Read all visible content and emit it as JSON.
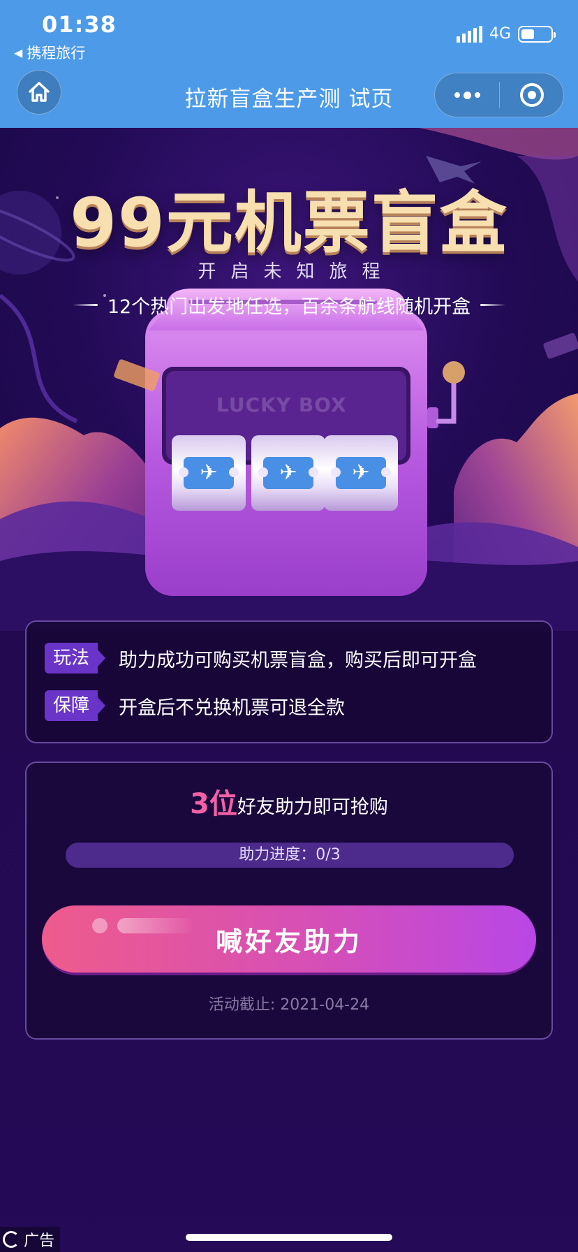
{
  "status_bar": {
    "time": "01:38",
    "back_app": "携程旅行",
    "network": "4G",
    "battery_level": 0.45
  },
  "header": {
    "title": "拉新盲盒生产测 试页",
    "home_icon": "home-icon",
    "more_icon": "more-dots-icon",
    "close_icon": "target-close-icon"
  },
  "banner": {
    "title": "99元机票盲盒",
    "tagline": "开启未知旅程",
    "subline": "12个热门出发地任选，百余条航线随机开盒",
    "machine_label": "LUCKY BOX",
    "reel_icons": [
      "plane-ticket-icon",
      "plane-ticket-icon",
      "plane-ticket-icon"
    ]
  },
  "info": {
    "rules": [
      {
        "tag": "玩法",
        "text": "助力成功可购买机票盲盒，购买后即可开盒"
      },
      {
        "tag": "保障",
        "text": "开盒后不兑换机票可退全款"
      }
    ]
  },
  "help": {
    "count": "3位",
    "title_rest": "好友助力即可抢购",
    "progress_text": "助力进度：0/3",
    "progress_value": 0,
    "progress_total": 3,
    "cta_label": "喊好友助力",
    "deadline": "活动截止: 2021-04-24"
  },
  "footer": {
    "ad_label": "广告"
  },
  "colors": {
    "header_bg": "#4c9ae8",
    "page_bg": "#1d0a45",
    "accent_pink": "#f261a6",
    "cta_start": "#ee5b8c",
    "cta_end": "#b947e6",
    "tag_bg": "#6a34c8"
  }
}
